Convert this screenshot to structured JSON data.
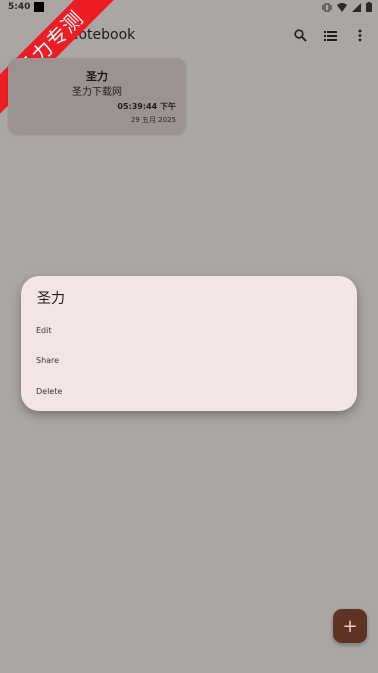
{
  "status_bar": {
    "time": "5:40",
    "icons": [
      "vibrate-icon",
      "wifi-icon",
      "signal-icon",
      "battery-icon"
    ]
  },
  "app_bar": {
    "title": "Notebook",
    "actions": [
      "search-icon",
      "list-view-icon",
      "more-vert-icon"
    ]
  },
  "ribbon": {
    "text": "圣力专测",
    "color": "#ee1c25"
  },
  "note": {
    "title": "圣力",
    "body": "圣力下载网",
    "time": "05:39:44 下午",
    "date": "29 五月 2025"
  },
  "dialog": {
    "title": "圣力",
    "items": [
      "Edit",
      "Share",
      "Delete"
    ]
  },
  "fab": {
    "label": "+",
    "color": "#5f3323"
  }
}
